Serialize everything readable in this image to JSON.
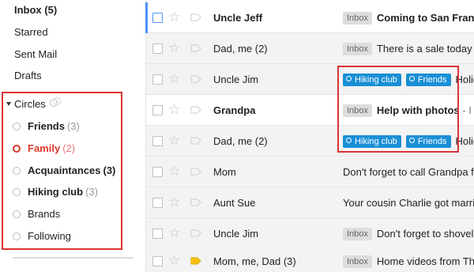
{
  "nav": {
    "items": [
      {
        "label": "Inbox (5)",
        "bold": true
      },
      {
        "label": "Starred",
        "bold": false
      },
      {
        "label": "Sent Mail",
        "bold": false
      },
      {
        "label": "Drafts",
        "bold": false
      }
    ],
    "circles": {
      "heading": "Circles",
      "items": [
        {
          "name": "Friends",
          "count": "(3)"
        },
        {
          "name": "Family",
          "count": "(2)"
        },
        {
          "name": "Acquaintances",
          "count": "(3)"
        },
        {
          "name": "Hiking club",
          "count": "(3)"
        },
        {
          "name": "Brands",
          "count": ""
        },
        {
          "name": "Following",
          "count": ""
        }
      ]
    }
  },
  "messages": [
    {
      "sender": "Uncle Jeff",
      "labels": [
        "Inbox"
      ],
      "subject": "Coming to San Francisco",
      "snippet": ""
    },
    {
      "sender": "Dad, me (2)",
      "labels": [
        "Inbox"
      ],
      "subject": "There is a sale today on",
      "snippet": ""
    },
    {
      "sender": "Uncle Jim",
      "labels": [
        "Hiking club",
        "Friends"
      ],
      "subject": "Holiday",
      "snippet": ""
    },
    {
      "sender": "Grandpa",
      "labels": [
        "Inbox"
      ],
      "subject": "Help with photos",
      "snippet": " - I am"
    },
    {
      "sender": "Dad, me (2)",
      "labels": [
        "Hiking club",
        "Friends"
      ],
      "subject": "Holiday",
      "snippet": ""
    },
    {
      "sender": "Mom",
      "labels": [],
      "subject": "Don't forget to call Grandpa for his",
      "snippet": ""
    },
    {
      "sender": "Aunt Sue",
      "labels": [],
      "subject": "Your cousin Charlie got married",
      "snippet": ""
    },
    {
      "sender": "Uncle Jim",
      "labels": [
        "Inbox"
      ],
      "subject": "Don't forget to shovel",
      "snippet": ""
    },
    {
      "sender": "Mom, me, Dad (3)",
      "labels": [
        "Inbox"
      ],
      "subject": "Home videos from Thanksgiving",
      "snippet": ""
    }
  ],
  "colors": {
    "accent_red": "#d33333",
    "label_blue": "#1a8fd6",
    "important_yellow": "#f4c20d"
  }
}
